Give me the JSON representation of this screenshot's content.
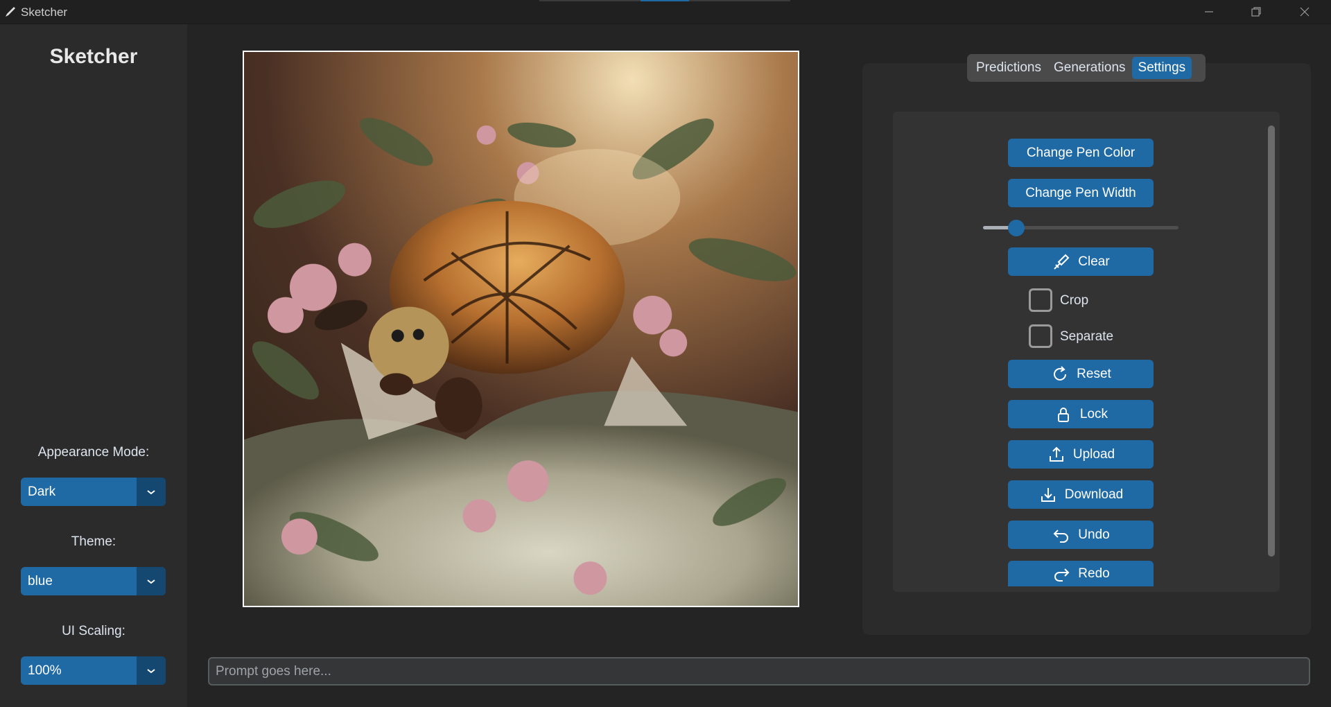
{
  "window": {
    "title": "Sketcher",
    "controls": [
      "minimize-icon",
      "restore-icon",
      "close-icon"
    ]
  },
  "sidebar": {
    "logo": "Sketcher",
    "appearance": {
      "label": "Appearance Mode:",
      "value": "Dark"
    },
    "theme": {
      "label": "Theme:",
      "value": "blue"
    },
    "scaling": {
      "label": "UI Scaling:",
      "value": "100%"
    }
  },
  "tabs": [
    {
      "label": "Predictions",
      "active": false
    },
    {
      "label": "Generations",
      "active": false
    },
    {
      "label": "Settings",
      "active": true
    }
  ],
  "settings": {
    "pen_color": "Change Pen Color",
    "pen_width": "Change Pen Width",
    "pen_width_level": 0.17,
    "clear": "Clear",
    "crop": "Crop",
    "separate": "Separate",
    "reset": "Reset",
    "lock": "Lock",
    "upload": "Upload",
    "download": "Download",
    "undo": "Undo",
    "redo": "Redo"
  },
  "prompt": {
    "placeholder": "Prompt goes here..."
  },
  "colors": {
    "accent": "#1f6aa5",
    "accent_dark": "#144870",
    "background": "#242424",
    "panel": "#2b2b2b"
  }
}
